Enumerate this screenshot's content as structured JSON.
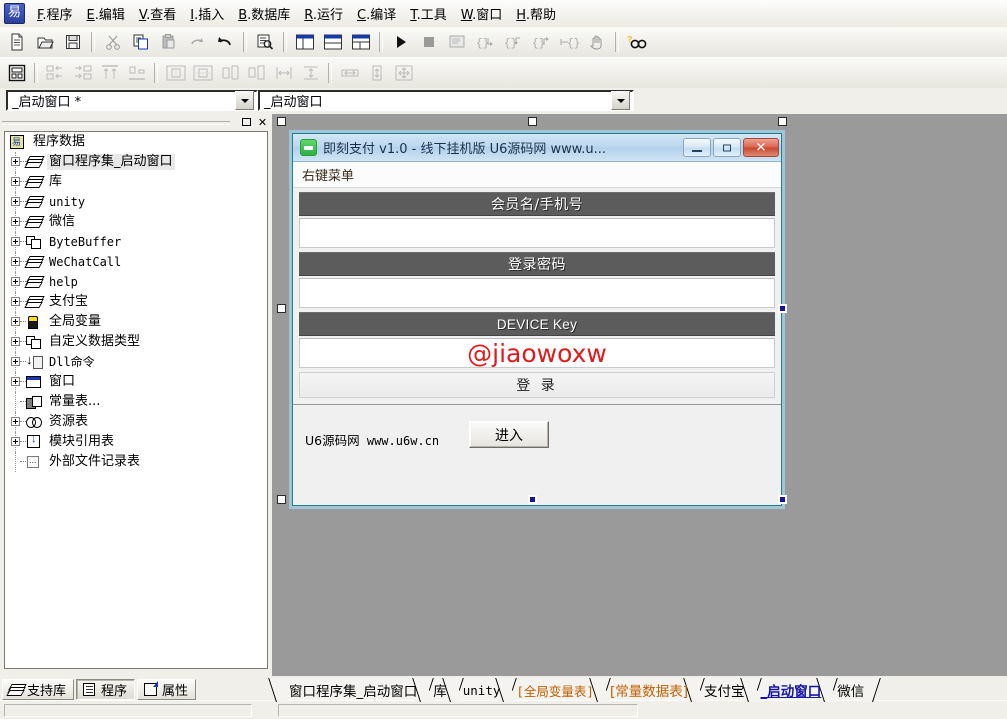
{
  "app": {
    "logo_icon": "epl-logo-icon",
    "menus": [
      {
        "accel": "F",
        "label": ".程序"
      },
      {
        "accel": "E",
        "label": ".编辑"
      },
      {
        "accel": "V",
        "label": ".查看"
      },
      {
        "accel": "I",
        "label": ".插入"
      },
      {
        "accel": "B",
        "label": ".数据库"
      },
      {
        "accel": "R",
        "label": ".运行"
      },
      {
        "accel": "C",
        "label": ".编译"
      },
      {
        "accel": "T",
        "label": ".工具"
      },
      {
        "accel": "W",
        "label": ".窗口"
      },
      {
        "accel": "H",
        "label": ".帮助"
      }
    ]
  },
  "toolbar_main": {
    "buttons": [
      {
        "name": "new-file-icon",
        "glyph": "📄"
      },
      {
        "name": "open-folder-icon",
        "glyph": "📂"
      },
      {
        "name": "save-icon",
        "glyph": "💾"
      },
      {
        "name": "separator",
        "glyph": ""
      },
      {
        "name": "cut-icon",
        "glyph": "✂"
      },
      {
        "name": "copy-icon",
        "glyph": "⧉"
      },
      {
        "name": "paste-icon",
        "glyph": "📋"
      },
      {
        "name": "redo-icon",
        "glyph": "↷"
      },
      {
        "name": "undo-icon",
        "glyph": "↶"
      },
      {
        "name": "separator",
        "glyph": ""
      },
      {
        "name": "find-icon",
        "glyph": "🔍"
      },
      {
        "name": "separator",
        "glyph": ""
      },
      {
        "name": "layout-split-left-icon",
        "glyph": ""
      },
      {
        "name": "layout-split-top-icon",
        "glyph": ""
      },
      {
        "name": "layout-grid-icon",
        "glyph": ""
      },
      {
        "name": "separator",
        "glyph": ""
      },
      {
        "name": "run-icon",
        "glyph": "▶"
      },
      {
        "name": "stop-icon",
        "glyph": "■"
      },
      {
        "name": "debug-window-icon",
        "glyph": ""
      },
      {
        "name": "step-over-icon",
        "glyph": "{}↴"
      },
      {
        "name": "step-into-icon",
        "glyph": "{↓}"
      },
      {
        "name": "step-out-icon",
        "glyph": "{↑}"
      },
      {
        "name": "run-to-cursor-icon",
        "glyph": "→{}"
      },
      {
        "name": "pause-hand-icon",
        "glyph": "✋"
      },
      {
        "name": "separator",
        "glyph": ""
      },
      {
        "name": "help-search-icon",
        "glyph": "🔎"
      }
    ]
  },
  "toolbar_align": {
    "buttons": [
      {
        "name": "form-designer-icon"
      },
      {
        "name": "separator"
      },
      {
        "name": "align-left-icon"
      },
      {
        "name": "align-right-icon"
      },
      {
        "name": "align-top-icon"
      },
      {
        "name": "align-bottom-icon"
      },
      {
        "name": "separator"
      },
      {
        "name": "center-horizontal-icon"
      },
      {
        "name": "center-vertical-icon"
      },
      {
        "name": "same-width-icon"
      },
      {
        "name": "same-height-icon"
      },
      {
        "name": "space-horizontal-icon"
      },
      {
        "name": "space-vertical-icon"
      },
      {
        "name": "separator"
      },
      {
        "name": "size-width-icon"
      },
      {
        "name": "size-height-icon"
      },
      {
        "name": "size-both-icon"
      }
    ]
  },
  "combos": {
    "program_selector": {
      "value": "_启动窗口 *",
      "arrow_icon": "chevron-down-icon"
    },
    "object_selector": {
      "value": "_启动窗口",
      "arrow_icon": "chevron-down-icon"
    }
  },
  "panel": {
    "restore_icon": "restore-window-icon",
    "close_icon": "close-window-icon",
    "tree": [
      {
        "label": "程序数据",
        "icon": "project-root-icon",
        "depth": 0,
        "expandable": false,
        "selected": false,
        "mono": false
      },
      {
        "label": "窗口程序集_启动窗口",
        "icon": "code-module-icon",
        "depth": 1,
        "expandable": true,
        "selected": true,
        "mono": false
      },
      {
        "label": "库",
        "icon": "code-module-icon",
        "depth": 1,
        "expandable": true,
        "selected": false,
        "mono": false
      },
      {
        "label": "unity",
        "icon": "code-module-icon",
        "depth": 1,
        "expandable": true,
        "selected": false,
        "mono": true
      },
      {
        "label": "微信",
        "icon": "code-module-icon",
        "depth": 1,
        "expandable": true,
        "selected": false,
        "mono": false
      },
      {
        "label": "ByteBuffer",
        "icon": "custom-type-icon",
        "depth": 1,
        "expandable": true,
        "selected": false,
        "mono": true
      },
      {
        "label": "WeChatCall",
        "icon": "code-module-icon",
        "depth": 1,
        "expandable": true,
        "selected": false,
        "mono": true
      },
      {
        "label": "help",
        "icon": "code-module-icon",
        "depth": 1,
        "expandable": true,
        "selected": false,
        "mono": true
      },
      {
        "label": "支付宝",
        "icon": "code-module-icon",
        "depth": 1,
        "expandable": true,
        "selected": false,
        "mono": false
      },
      {
        "label": "全局变量",
        "icon": "global-variable-icon",
        "depth": 1,
        "expandable": true,
        "selected": false,
        "mono": false
      },
      {
        "label": "自定义数据类型",
        "icon": "custom-type-icon",
        "depth": 1,
        "expandable": true,
        "selected": false,
        "mono": false
      },
      {
        "label": "Dll命令",
        "icon": "dll-command-icon",
        "depth": 1,
        "expandable": true,
        "selected": false,
        "mono": true
      },
      {
        "label": "窗口",
        "icon": "window-icon",
        "depth": 1,
        "expandable": true,
        "selected": false,
        "mono": false
      },
      {
        "label": "常量表...",
        "icon": "constant-table-icon",
        "depth": 1,
        "expandable": false,
        "selected": false,
        "mono": false
      },
      {
        "label": "资源表",
        "icon": "resource-table-icon",
        "depth": 1,
        "expandable": true,
        "selected": false,
        "mono": false
      },
      {
        "label": "模块引用表",
        "icon": "module-reference-icon",
        "depth": 1,
        "expandable": true,
        "selected": false,
        "mono": false
      },
      {
        "label": "外部文件记录表",
        "icon": "external-file-icon",
        "depth": 1,
        "expandable": false,
        "selected": false,
        "mono": false
      }
    ]
  },
  "dialog": {
    "icon": "app-green-icon",
    "title": "即刻支付 v1.0 - 线下挂机版 U6源码网 www.u...",
    "minimize_label": "minimize",
    "maximize_label": "maximize",
    "close_label": "✕",
    "menu_label": "右键菜单",
    "fields": [
      {
        "header": "会员名/手机号",
        "value": "",
        "latin": false
      },
      {
        "header": "登录密码",
        "value": "",
        "latin": false
      },
      {
        "header": "DEVICE Key",
        "value": "@jiaowoxw",
        "latin": true
      }
    ],
    "login_button": "登 录",
    "footer": {
      "brand": "U6源码网",
      "url": "www.u6w.cn",
      "enter_button": "进入"
    }
  },
  "bottom": {
    "left_tabs": [
      {
        "label": "支持库",
        "icon": "support-library-icon",
        "active": false
      },
      {
        "label": "程序",
        "icon": "program-tree-icon",
        "active": true
      },
      {
        "label": "属性",
        "icon": "properties-icon",
        "active": false
      }
    ],
    "file_tabs": [
      {
        "label": "窗口程序集_启动窗口",
        "style": "normal",
        "mono": false
      },
      {
        "label": "库",
        "style": "normal",
        "mono": false
      },
      {
        "label": "unity",
        "style": "normal",
        "mono": true
      },
      {
        "label": "[全局变量表]",
        "style": "orange",
        "mono": true
      },
      {
        "label": "[常量数据表]",
        "style": "orange",
        "mono": false
      },
      {
        "label": "支付宝",
        "style": "normal",
        "mono": false
      },
      {
        "label": "_启动窗口",
        "style": "active",
        "mono": false
      },
      {
        "label": "微信",
        "style": "normal",
        "mono": false
      }
    ]
  },
  "colors": {
    "design_surface": "#9a9a9a",
    "field_header": "#5c5c5c",
    "watermark": "#e01b1b",
    "active_tab": "#1414a8",
    "bracket_tab": "#c06000",
    "selection_handle": "#17179e"
  }
}
